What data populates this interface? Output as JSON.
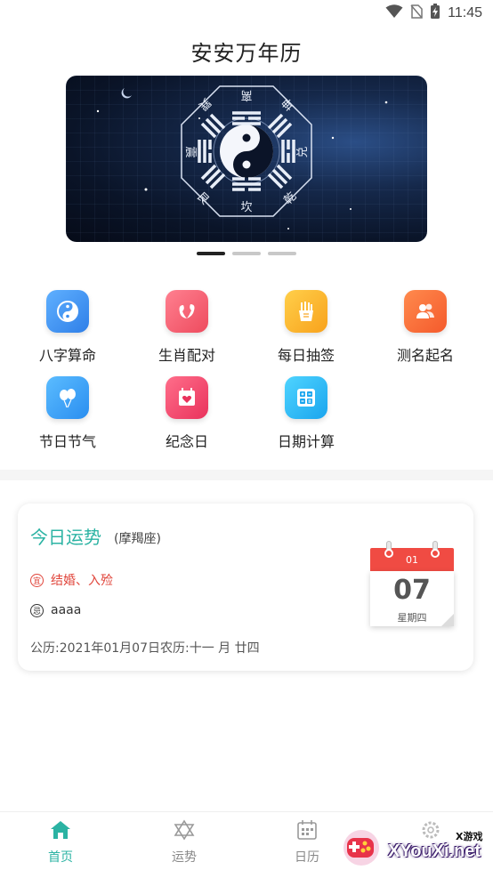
{
  "status_bar": {
    "time": "11:45",
    "icons": [
      "wifi-icon",
      "no-sim-icon",
      "battery-charging-icon"
    ]
  },
  "header": {
    "title": "安安万年历"
  },
  "banner": {
    "trigrams": [
      "离",
      "坤",
      "兑",
      "乾",
      "坎",
      "艮",
      "震",
      "巽"
    ],
    "page_count": 3,
    "active_page": 1
  },
  "features": [
    {
      "label": "八字算命",
      "icon": "yin-yang-icon",
      "color": "#3a8ef0"
    },
    {
      "label": "生肖配对",
      "icon": "zodiac-pair-icon",
      "color": "#f25a6a"
    },
    {
      "label": "每日抽签",
      "icon": "fortune-sticks-icon",
      "color": "#fbb12b"
    },
    {
      "label": "测名起名",
      "icon": "naming-icon",
      "color": "#f7653a"
    },
    {
      "label": "节日节气",
      "icon": "balloon-icon",
      "color": "#2e9cf2"
    },
    {
      "label": "纪念日",
      "icon": "calendar-heart-icon",
      "color": "#f0436d"
    },
    {
      "label": "日期计算",
      "icon": "calculator-icon",
      "color": "#27b6f2"
    }
  ],
  "fortune": {
    "title": "今日运势",
    "sign": "(摩羯座)",
    "yi_badge": "宜",
    "yi": "结婚、入殓",
    "ji_badge": "忌",
    "ji": "aaaa",
    "date_line": "公历:2021年01月07日农历:十一 月 廿四",
    "calendar": {
      "month": "01",
      "day": "07",
      "weekday": "星期四"
    }
  },
  "bottom_nav": [
    {
      "label": "首页",
      "icon": "home-icon",
      "active": true
    },
    {
      "label": "运势",
      "icon": "star-of-david-icon",
      "active": false
    },
    {
      "label": "日历",
      "icon": "calendar-icon",
      "active": false
    },
    {
      "label": "",
      "icon": "gear-icon",
      "active": false
    }
  ],
  "watermark": {
    "text": "XYouXi.net",
    "small": "X游戏"
  },
  "colors": {
    "accent": "#2bb3a3",
    "red": "#e0443a"
  }
}
